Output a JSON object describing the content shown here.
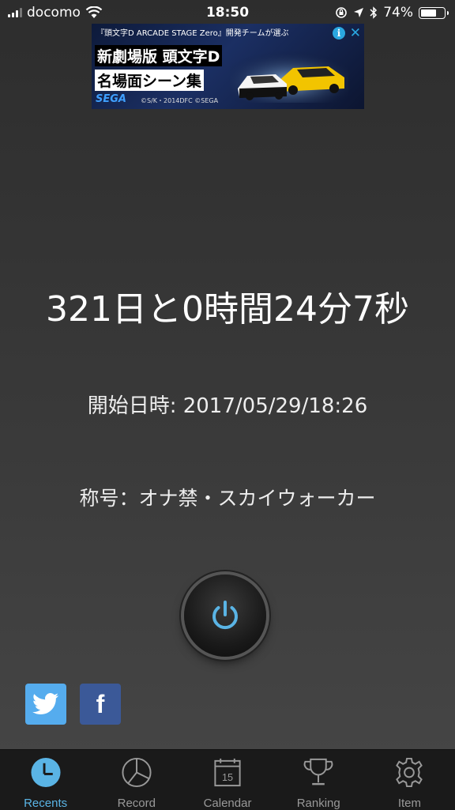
{
  "status_bar": {
    "carrier": "docomo",
    "time": "18:50",
    "battery_percent": "74%",
    "battery_level": 0.74
  },
  "ad": {
    "top_text": "『頭文字D ARCADE STAGE Zero』開発チームが選ぶ",
    "line1": "新劇場版 頭文字D",
    "line2": "名場面シーン集",
    "logo": "SEGA",
    "copyright": "©S/K・2014DFC ©SEGA",
    "info_icon": "i",
    "close_icon": "✕"
  },
  "main": {
    "elapsed": "321日と0時間24分7秒",
    "start_label": "開始日時: 2017/05/29/18:26",
    "title_label": "称号：オナ禁・スカイウォーカー"
  },
  "share": {
    "facebook_glyph": "f"
  },
  "tabs": [
    {
      "label": "Recents",
      "icon": "clock-icon"
    },
    {
      "label": "Record",
      "icon": "pie-chart-icon"
    },
    {
      "label": "Calendar",
      "icon": "calendar-icon",
      "badge": "15"
    },
    {
      "label": "Ranking",
      "icon": "trophy-icon"
    },
    {
      "label": "Item",
      "icon": "gear-icon"
    }
  ],
  "colors": {
    "accent": "#5ab4e5",
    "twitter": "#55acee",
    "facebook": "#3b5998",
    "tabbar": "#1a1a1a"
  }
}
